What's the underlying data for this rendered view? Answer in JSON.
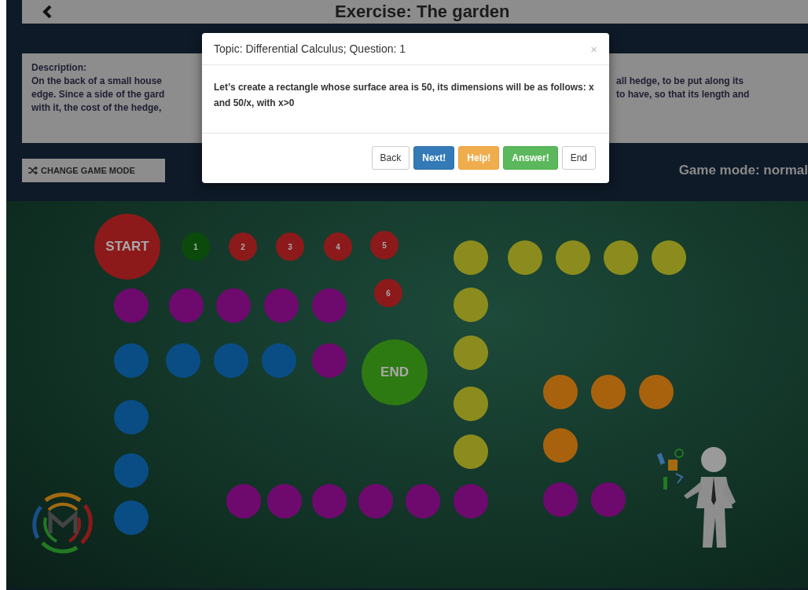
{
  "header": {
    "title": "Exercise: The garden"
  },
  "description": {
    "label": "Description:",
    "left_lines": [
      "On the back of a small house",
      "edge. Since a side of the gard",
      "with it, the cost of the hedge,"
    ],
    "right_lines": [
      "all hedge, to be put along its",
      "to have, so that its length and"
    ]
  },
  "change_mode_button": "CHANGE GAME MODE",
  "game_mode": "Game mode: normal",
  "board": {
    "cells": [
      {
        "kind": "start",
        "label": "START",
        "color": "#8c1a1a"
      },
      {
        "kind": "number",
        "label": "1",
        "color": "#0b4a0b"
      },
      {
        "kind": "number",
        "label": "2",
        "color": "#8c1a1a"
      },
      {
        "kind": "number",
        "label": "3",
        "color": "#8c1a1a"
      },
      {
        "kind": "number",
        "label": "4",
        "color": "#8c1a1a"
      },
      {
        "kind": "number",
        "label": "5",
        "color": "#8c1a1a"
      },
      {
        "kind": "number",
        "label": "6",
        "color": "#8c1a1a"
      },
      {
        "kind": "cell",
        "color": "#6e0a6e"
      },
      {
        "kind": "cell",
        "color": "#6e0a6e"
      },
      {
        "kind": "cell",
        "color": "#6e0a6e"
      },
      {
        "kind": "cell",
        "color": "#6e0a6e"
      },
      {
        "kind": "cell",
        "color": "#6e0a6e"
      },
      {
        "kind": "cell",
        "color": "#0a4d85"
      },
      {
        "kind": "cell",
        "color": "#0a4d85"
      },
      {
        "kind": "cell",
        "color": "#0a4d85"
      },
      {
        "kind": "cell",
        "color": "#0a4d85"
      },
      {
        "kind": "cell",
        "color": "#6e0a6e"
      },
      {
        "kind": "end",
        "label": "END",
        "color": "#2e7a12"
      },
      {
        "kind": "cell",
        "color": "#8c8c1e"
      },
      {
        "kind": "cell",
        "color": "#8c8c1e"
      },
      {
        "kind": "cell",
        "color": "#8c8c1e"
      },
      {
        "kind": "cell",
        "color": "#8c8c1e"
      },
      {
        "kind": "cell",
        "color": "#8c8c1e"
      },
      {
        "kind": "cell",
        "color": "#8c8c1e"
      },
      {
        "kind": "cell",
        "color": "#8c8c1e"
      },
      {
        "kind": "cell",
        "color": "#8c8c1e"
      },
      {
        "kind": "cell",
        "color": "#8c8c1e"
      },
      {
        "kind": "cell",
        "color": "#a8620e"
      },
      {
        "kind": "cell",
        "color": "#a8620e"
      },
      {
        "kind": "cell",
        "color": "#a8620e"
      },
      {
        "kind": "cell",
        "color": "#a8620e"
      },
      {
        "kind": "cell",
        "color": "#0a4d85"
      },
      {
        "kind": "cell",
        "color": "#0a4d85"
      },
      {
        "kind": "cell",
        "color": "#0a4d85"
      },
      {
        "kind": "cell",
        "color": "#6e0a6e"
      },
      {
        "kind": "cell",
        "color": "#6e0a6e"
      },
      {
        "kind": "cell",
        "color": "#6e0a6e"
      },
      {
        "kind": "cell",
        "color": "#6e0a6e"
      },
      {
        "kind": "cell",
        "color": "#6e0a6e"
      },
      {
        "kind": "cell",
        "color": "#6e0a6e"
      },
      {
        "kind": "cell",
        "color": "#6e0a6e"
      },
      {
        "kind": "cell",
        "color": "#6e0a6e"
      }
    ]
  },
  "modal": {
    "title": "Topic: Differential Calculus; Question: 1",
    "close": "×",
    "body": "Let’s create a rectangle whose surface area is 50, its dimensions will be as follows: x and 50/x, with x>0",
    "buttons": [
      {
        "label": "Back",
        "kind": "default"
      },
      {
        "label": "Next!",
        "kind": "primary"
      },
      {
        "label": "Help!",
        "kind": "warning"
      },
      {
        "label": "Answer!",
        "kind": "success"
      },
      {
        "label": "End",
        "kind": "default"
      }
    ]
  }
}
